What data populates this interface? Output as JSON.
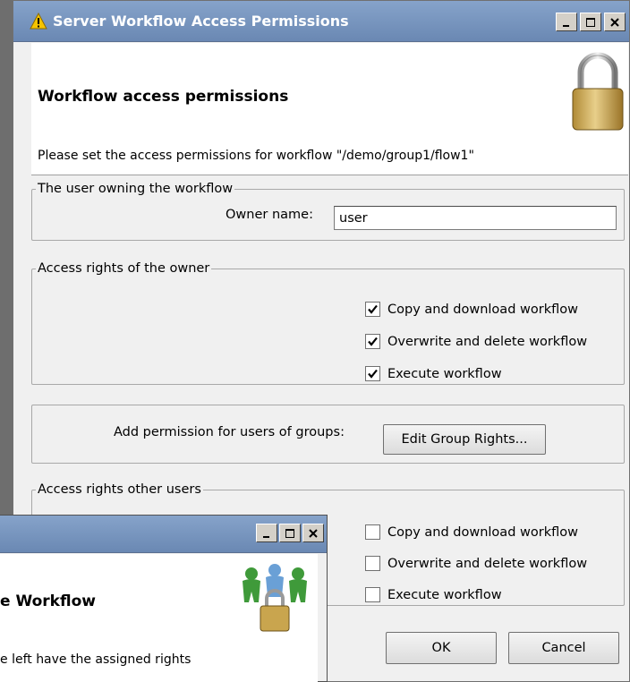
{
  "window": {
    "title": "Server Workflow Access Permissions",
    "minimize_glyph": "_",
    "maximize_glyph": "□",
    "close_glyph": "×"
  },
  "header": {
    "title": "Workflow access permissions",
    "message": "Please set the access permissions for workflow \"/demo/group1/flow1\"",
    "icon": "padlock-icon"
  },
  "owner_group": {
    "legend": "The user owning the workflow",
    "label": "Owner name:",
    "value": "user"
  },
  "owner_rights": {
    "legend": "Access rights of the owner",
    "options": [
      {
        "label": "Copy and download workflow",
        "checked": true
      },
      {
        "label": "Overwrite and delete workflow",
        "checked": true
      },
      {
        "label": "Execute workflow",
        "checked": true
      }
    ]
  },
  "group_perm": {
    "label": "Add permission for users of groups:",
    "button": "Edit Group Rights..."
  },
  "other_rights": {
    "legend": "Access rights other users",
    "options": [
      {
        "label": "Copy and download workflow",
        "checked": false
      },
      {
        "label": "Overwrite and delete workflow",
        "checked": false
      },
      {
        "label": "Execute workflow",
        "checked": false
      }
    ]
  },
  "footer": {
    "ok": "OK",
    "cancel": "Cancel"
  },
  "secondary_window": {
    "title_fragment": "e Workflow",
    "message_fragment": "e left have the assigned rights",
    "icon": "users-lock-icon"
  },
  "colors": {
    "titlebar": "#7895bd",
    "panel": "#f0f0f0",
    "desktop": "#808080"
  }
}
